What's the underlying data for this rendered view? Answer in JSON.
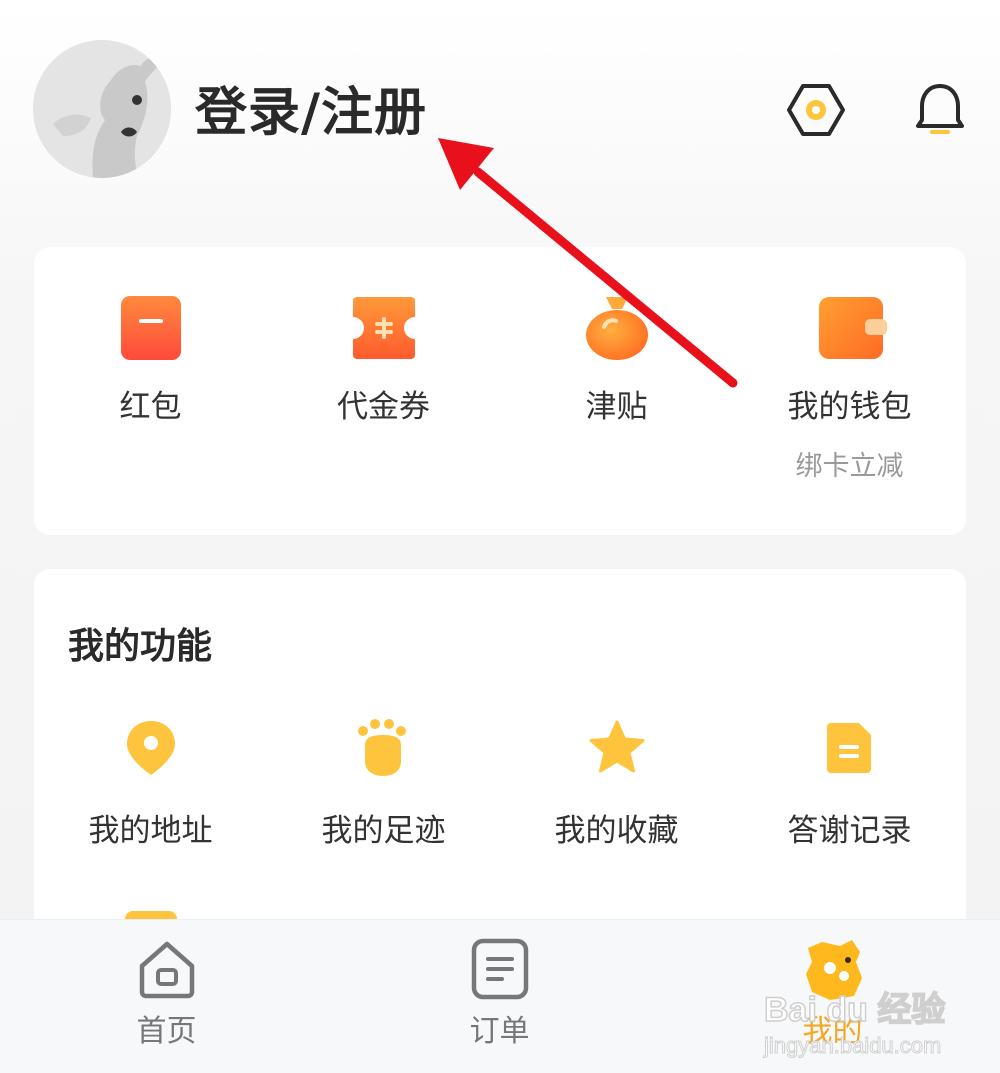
{
  "header": {
    "login_label": "登录/注册",
    "avatar_icon": "dog-avatar-icon",
    "scan_icon": "hexagon-settings-icon",
    "bell_icon": "bell-icon"
  },
  "wallet": {
    "items": [
      {
        "label": "红包",
        "sub": "",
        "icon": "red-packet-icon"
      },
      {
        "label": "代金券",
        "sub": "",
        "icon": "coupon-icon"
      },
      {
        "label": "津贴",
        "sub": "",
        "icon": "money-bag-icon"
      },
      {
        "label": "我的钱包",
        "sub": "绑卡立减",
        "icon": "wallet-icon"
      }
    ]
  },
  "functions": {
    "title": "我的功能",
    "items": [
      {
        "label": "我的地址",
        "icon": "location-pin-icon"
      },
      {
        "label": "我的足迹",
        "icon": "paw-print-icon"
      },
      {
        "label": "我的收藏",
        "icon": "star-icon"
      },
      {
        "label": "答谢记录",
        "icon": "document-icon"
      }
    ]
  },
  "tabbar": {
    "tabs": [
      {
        "label": "首页",
        "icon": "home-icon",
        "active": false
      },
      {
        "label": "订单",
        "icon": "order-list-icon",
        "active": false
      },
      {
        "label": "我的",
        "icon": "dog-mascot-icon",
        "active": true
      }
    ]
  },
  "colors": {
    "accent": "#f5a623",
    "icon_yellow": "#ffc43d",
    "wallet_red": "#ff5a36",
    "arrow_red": "#e8101a"
  },
  "watermark": {
    "logo": "Bai du 经验",
    "url": "jingyan.baidu.com"
  }
}
